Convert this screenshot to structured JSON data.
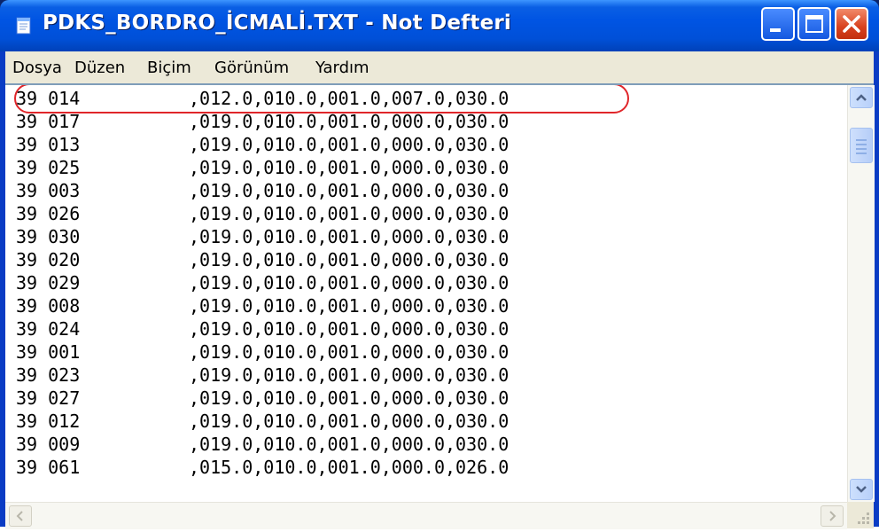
{
  "window": {
    "title": "PDKS_BORDRO_İCMALİ.TXT - Not Defteri"
  },
  "menu": [
    {
      "label": "Dosya"
    },
    {
      "label": "Düzen"
    },
    {
      "label": "Biçim"
    },
    {
      "label": "Görünüm"
    },
    {
      "label": "Yardım"
    }
  ],
  "editor": {
    "highlighted_line": 0,
    "highlight_color": "#e0262a",
    "lines": [
      {
        "id": "39 014",
        "values": ",012.0,010.0,001.0,007.0,030.0"
      },
      {
        "id": "39 017",
        "values": ",019.0,010.0,001.0,000.0,030.0"
      },
      {
        "id": "39 013",
        "values": ",019.0,010.0,001.0,000.0,030.0"
      },
      {
        "id": "39 025",
        "values": ",019.0,010.0,001.0,000.0,030.0"
      },
      {
        "id": "39 003",
        "values": ",019.0,010.0,001.0,000.0,030.0"
      },
      {
        "id": "39 026",
        "values": ",019.0,010.0,001.0,000.0,030.0"
      },
      {
        "id": "39 030",
        "values": ",019.0,010.0,001.0,000.0,030.0"
      },
      {
        "id": "39 020",
        "values": ",019.0,010.0,001.0,000.0,030.0"
      },
      {
        "id": "39 029",
        "values": ",019.0,010.0,001.0,000.0,030.0"
      },
      {
        "id": "39 008",
        "values": ",019.0,010.0,001.0,000.0,030.0"
      },
      {
        "id": "39 024",
        "values": ",019.0,010.0,001.0,000.0,030.0"
      },
      {
        "id": "39 001",
        "values": ",019.0,010.0,001.0,000.0,030.0"
      },
      {
        "id": "39 023",
        "values": ",019.0,010.0,001.0,000.0,030.0"
      },
      {
        "id": "39 027",
        "values": ",019.0,010.0,001.0,000.0,030.0"
      },
      {
        "id": "39 012",
        "values": ",019.0,010.0,001.0,000.0,030.0"
      },
      {
        "id": "39 009",
        "values": ",019.0,010.0,001.0,000.0,030.0"
      },
      {
        "id": "39 061",
        "values": ",015.0,010.0,001.0,000.0,026.0"
      }
    ]
  },
  "icons": {
    "app": "notepad-icon",
    "minimize": "minimize-icon",
    "maximize": "maximize-icon",
    "close": "close-icon",
    "scroll_up": "chevron-up-icon",
    "scroll_down": "chevron-down-icon",
    "scroll_left": "chevron-left-icon",
    "scroll_right": "chevron-right-icon",
    "size_grip": "size-grip-icon"
  }
}
